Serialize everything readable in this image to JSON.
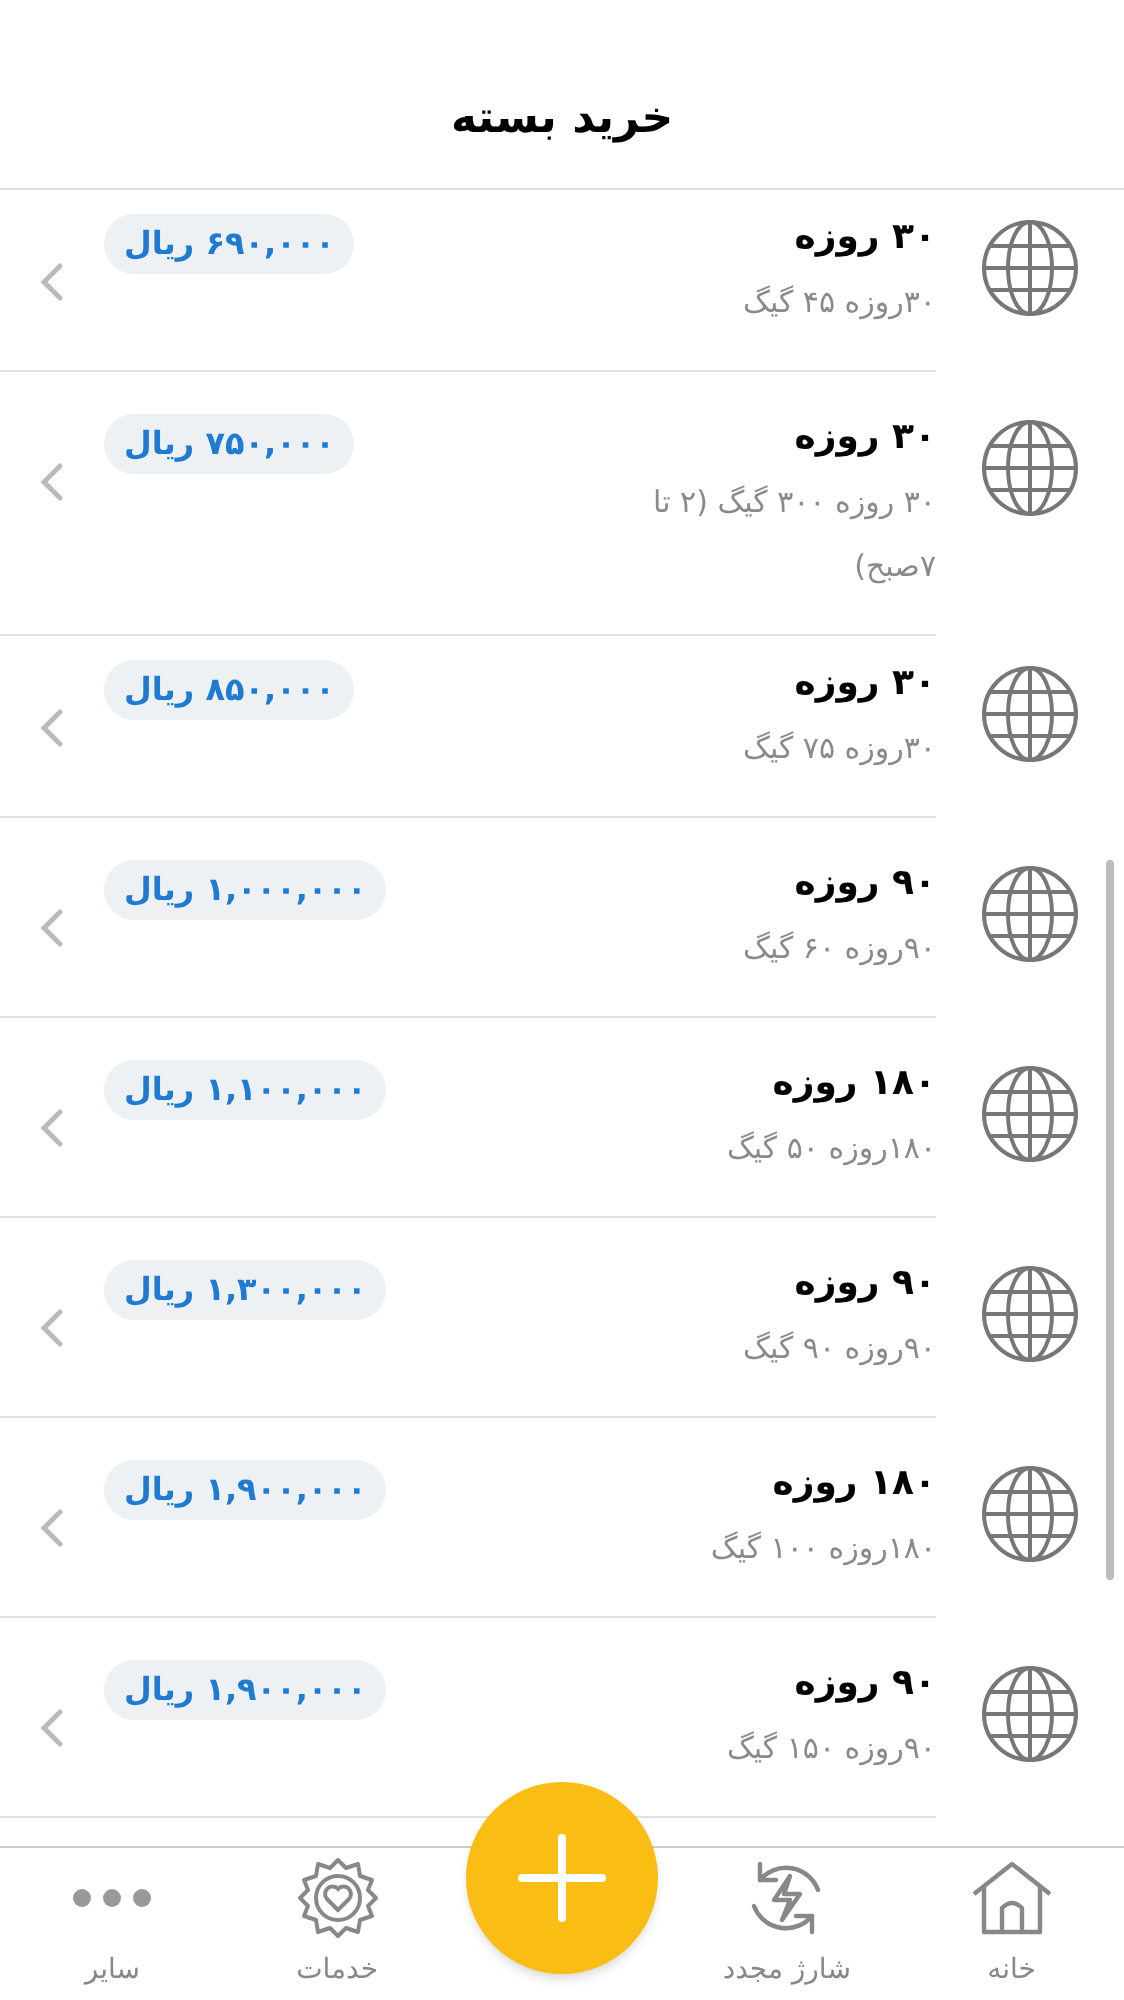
{
  "header": {
    "title": "خرید بسته"
  },
  "packages": [
    {
      "title": "۳۰ روزه",
      "description": "۳۰روزه ۴۵ گیگ",
      "price": "۶۹۰,۰۰۰ ریال"
    },
    {
      "title": "۳۰ روزه",
      "description": "۳۰ روزه ۳۰۰ گیگ (۲ تا ۷صبح)",
      "price": "۷۵۰,۰۰۰ ریال"
    },
    {
      "title": "۳۰ روزه",
      "description": "۳۰روزه ۷۵ گیگ",
      "price": "۸۵۰,۰۰۰ ریال"
    },
    {
      "title": "۹۰ روزه",
      "description": "۹۰روزه ۶۰ گیگ",
      "price": "۱,۰۰۰,۰۰۰ ریال"
    },
    {
      "title": "۱۸۰ روزه",
      "description": "۱۸۰روزه ۵۰ گیگ",
      "price": "۱,۱۰۰,۰۰۰ ریال"
    },
    {
      "title": "۹۰ روزه",
      "description": "۹۰روزه ۹۰ گیگ",
      "price": "۱,۳۰۰,۰۰۰ ریال"
    },
    {
      "title": "۱۸۰ روزه",
      "description": "۱۸۰روزه ۱۰۰ گیگ",
      "price": "۱,۹۰۰,۰۰۰ ریال"
    },
    {
      "title": "۹۰ روزه",
      "description": "۹۰روزه ۱۵۰ گیگ",
      "price": "۱,۹۰۰,۰۰۰ ریال"
    }
  ],
  "bottom_nav": [
    {
      "kind": "home",
      "label": "خانه"
    },
    {
      "kind": "recharge",
      "label": "شارژ مجدد"
    },
    {
      "kind": "add"
    },
    {
      "kind": "services",
      "label": "خدمات"
    },
    {
      "kind": "more",
      "label": "سایر"
    }
  ]
}
